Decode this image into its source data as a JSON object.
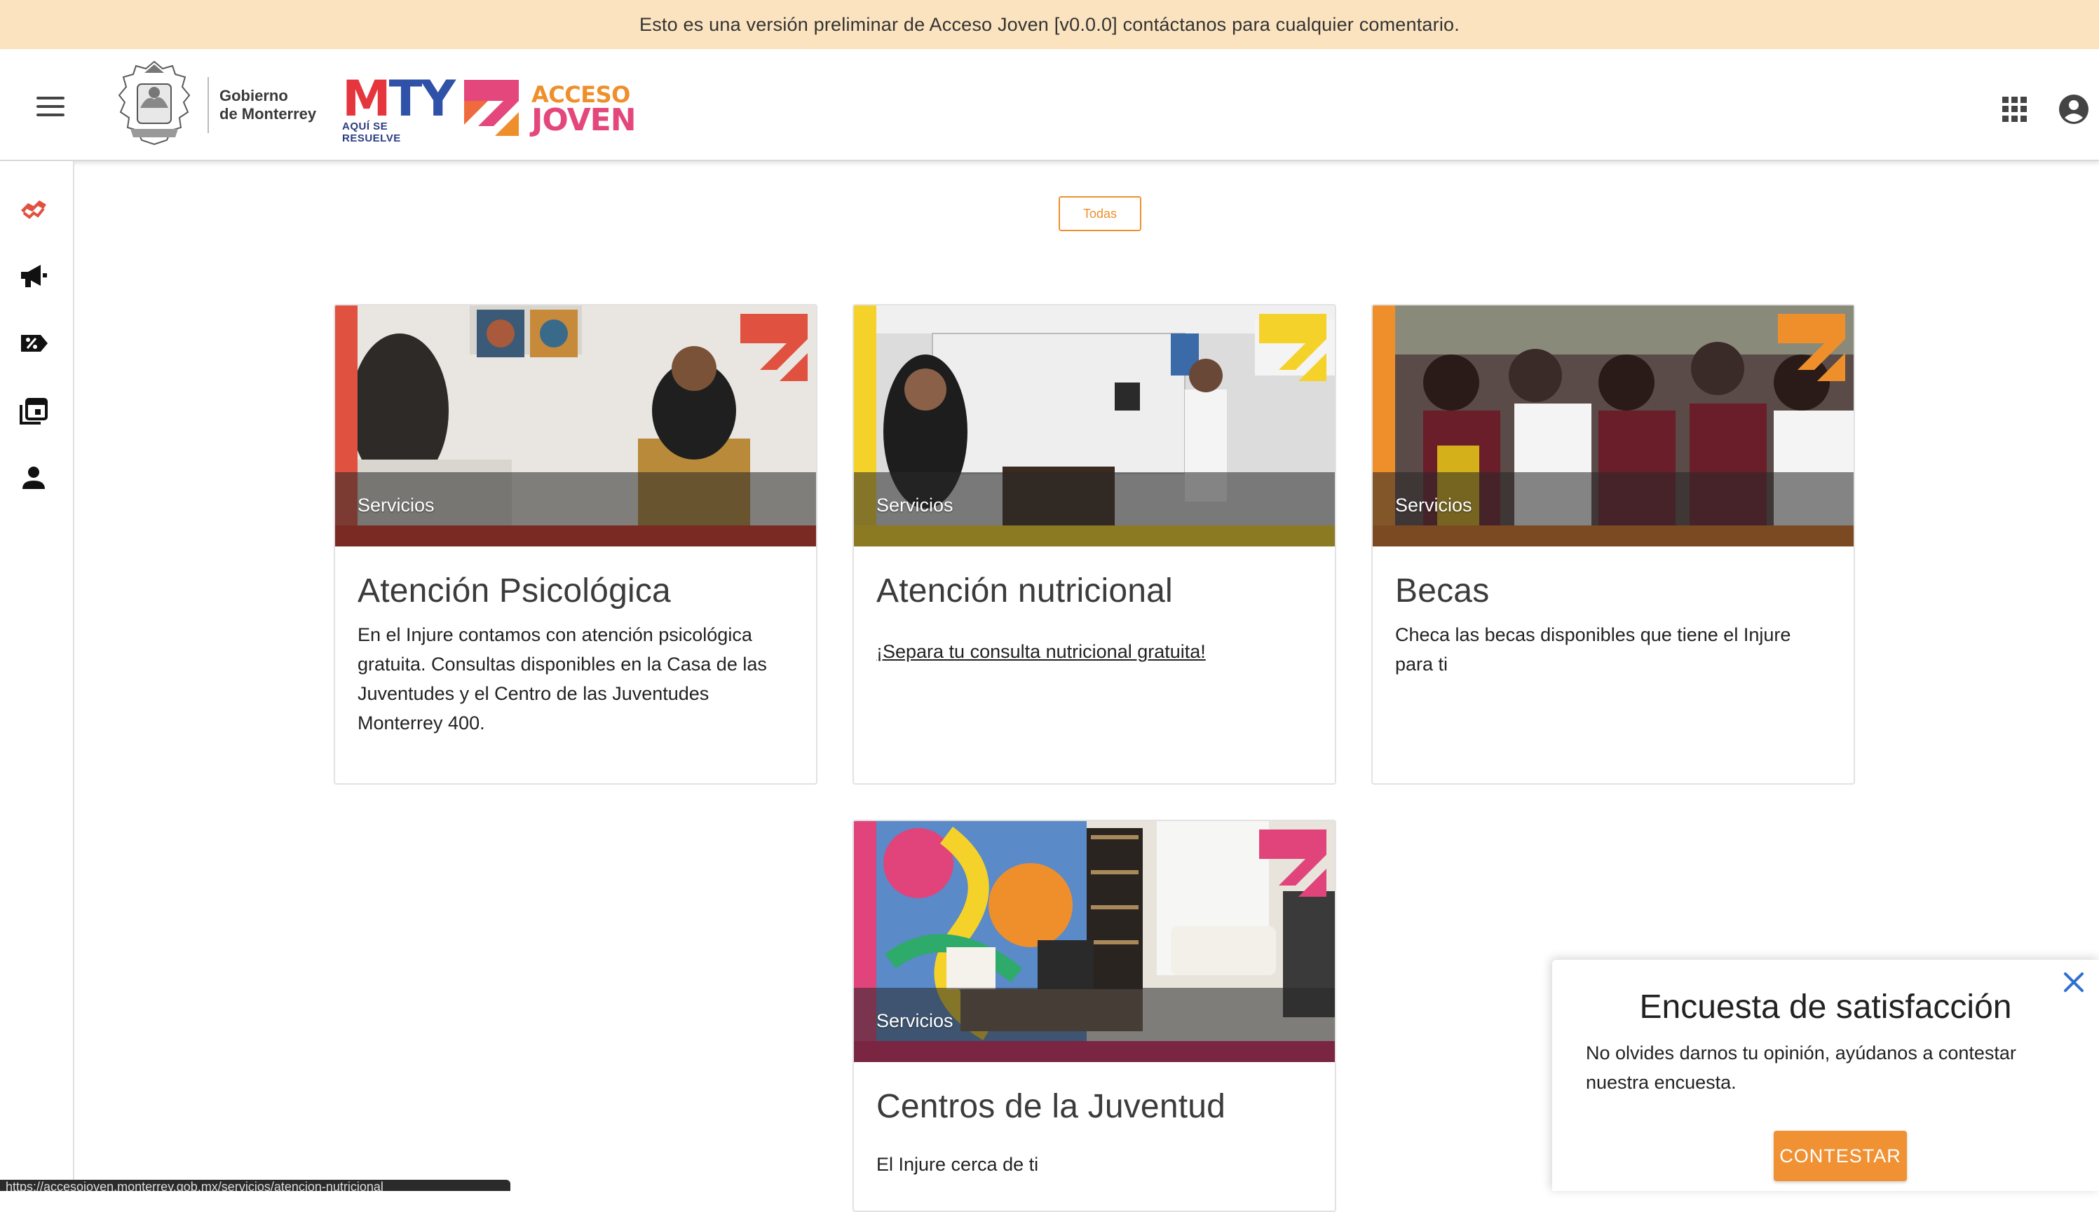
{
  "banner": {
    "text": "Esto es una versión preliminar de Acceso Joven [v0.0.0] contáctanos para cualquier comentario."
  },
  "header": {
    "gov_text_line1": "Gobierno",
    "gov_text_line2": "de Monterrey",
    "mty_letters": [
      "M",
      "T",
      "Y"
    ],
    "mty_tagline": "AQUÍ SE RESUELVE",
    "brand_line1": "ACCESO",
    "brand_line2": "JOVEN",
    "apps_icon": "apps-grid-icon",
    "account_icon": "account-circle-icon"
  },
  "sidenav": {
    "items": [
      {
        "icon": "handshake-icon",
        "active": true
      },
      {
        "icon": "megaphone-icon",
        "active": false
      },
      {
        "icon": "discount-tag-icon",
        "active": false
      },
      {
        "icon": "event-gallery-icon",
        "active": false
      },
      {
        "icon": "person-icon",
        "active": false
      }
    ]
  },
  "filter": {
    "label": "Todas"
  },
  "cards": [
    {
      "category": "Servicios",
      "title": "Atención Psicológica",
      "description": "En el Injure contamos con atención psicológica gratuita. Consultas disponibles en la Casa de las Juventudes y el Centro de las Juventudes Monterrey 400.",
      "link": "",
      "accent": "#e0513f",
      "bar": "#7a2a22"
    },
    {
      "category": "Servicios",
      "title": "Atención nutricional",
      "description": "",
      "link": "¡Separa tu consulta nutricional gratuita!",
      "accent": "#f5d22a",
      "bar": "#8c7a22"
    },
    {
      "category": "Servicios",
      "title": "Becas",
      "description": "Checa las becas disponibles que tiene el Injure para ti",
      "link": "",
      "accent": "#ef8f2c",
      "bar": "#7c4a22"
    },
    {
      "category": "Servicios",
      "title": "Centros de la Juventud",
      "description": "El Injure cerca de ti",
      "link": "",
      "accent": "#e0447b",
      "bar": "#7a2643"
    }
  ],
  "survey": {
    "title": "Encuesta de satisfacción",
    "text": "No olvides darnos tu opinión, ayúdanos a contestar nuestra encuesta.",
    "button": "CONTESTAR",
    "close_icon": "close-icon"
  },
  "statusbar": {
    "url": "https://accesojoven.monterrey.gob.mx/servicios/atencion-nutricional"
  }
}
